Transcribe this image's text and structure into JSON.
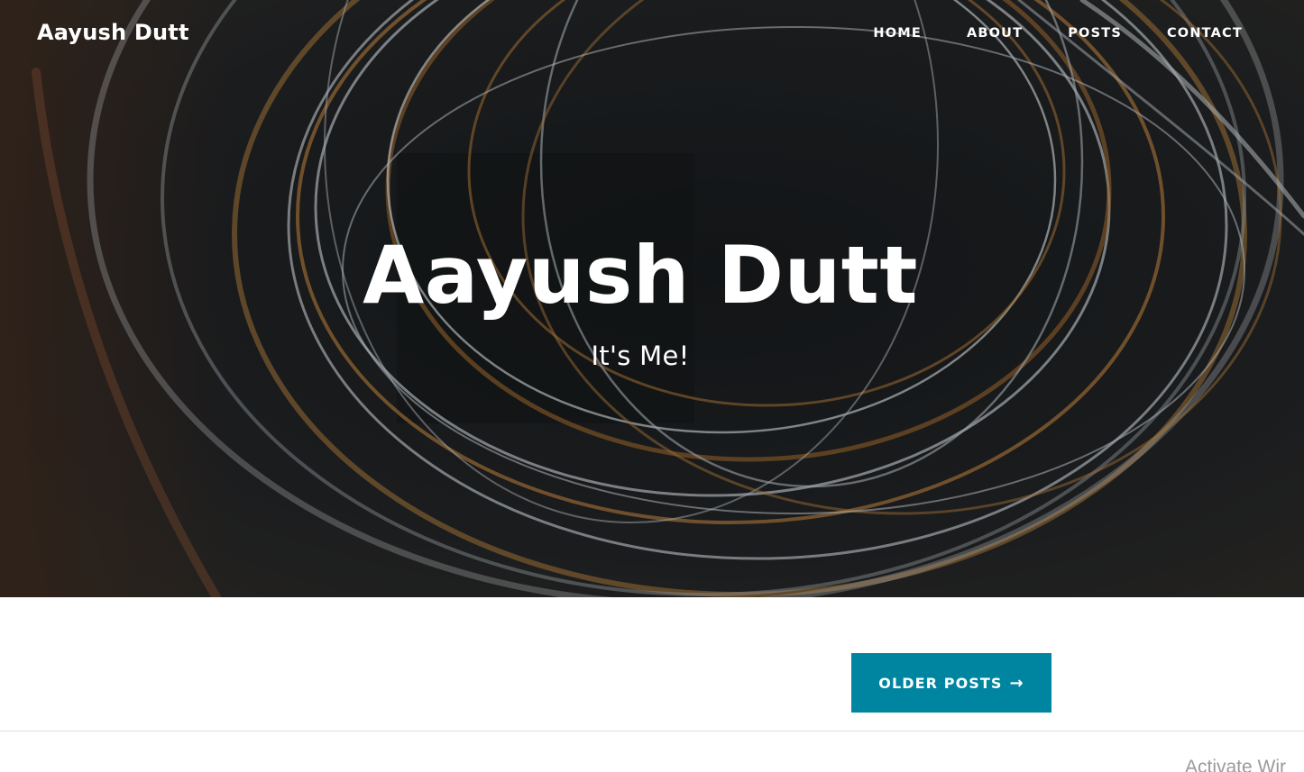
{
  "header": {
    "brand": "Aayush Dutt",
    "nav": [
      {
        "label": "HOME"
      },
      {
        "label": "ABOUT"
      },
      {
        "label": "POSTS"
      },
      {
        "label": "CONTACT"
      }
    ]
  },
  "hero": {
    "title": "Aayush Dutt",
    "subtitle": "It's Me!"
  },
  "pager": {
    "older_label": "OLDER POSTS",
    "arrow": "→"
  },
  "os_watermark": {
    "text": "Activate Wir"
  },
  "colors": {
    "accent": "#0085a1",
    "hero_dark": "#15171a",
    "text_light": "#ffffff"
  }
}
